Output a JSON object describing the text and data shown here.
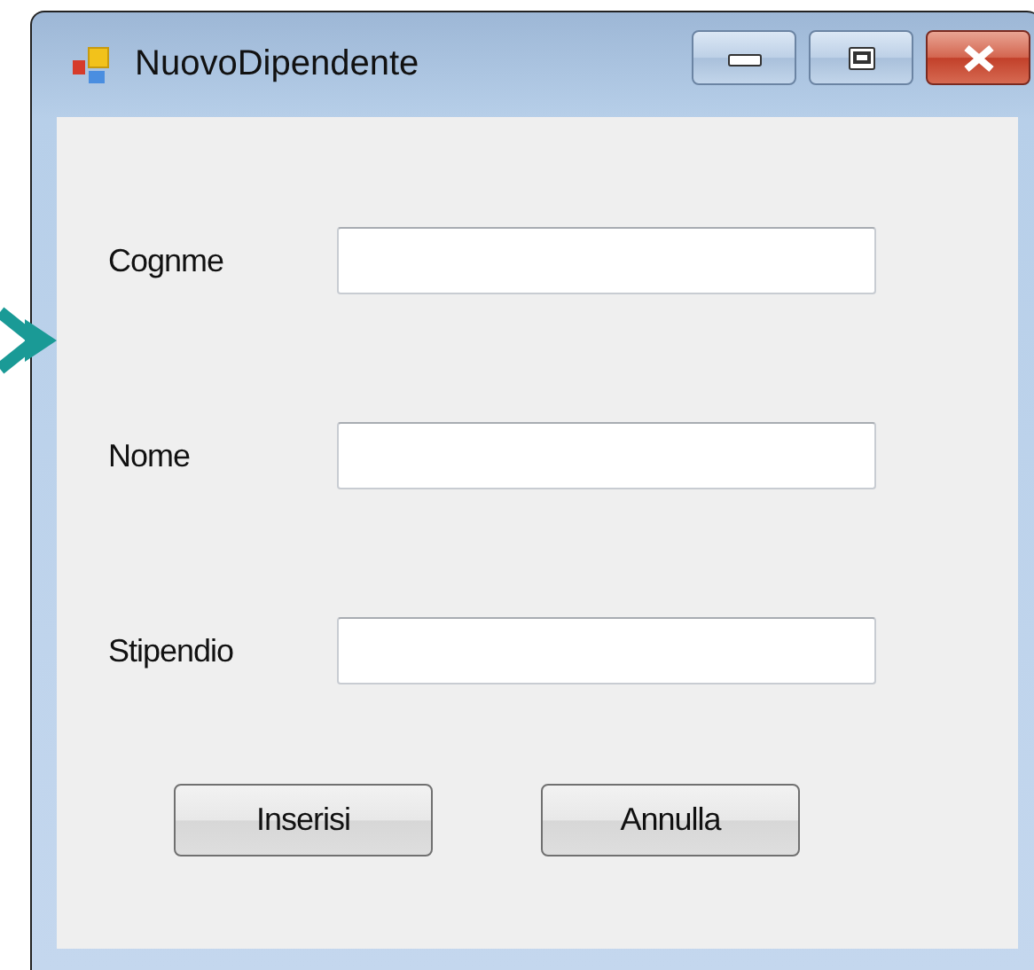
{
  "window": {
    "title": "NuovoDipendente"
  },
  "fields": [
    {
      "label": "Cognme"
    },
    {
      "label": "Nome"
    },
    {
      "label": "Stipendio"
    }
  ],
  "buttons": [
    "Inserisi",
    "Annulla"
  ]
}
